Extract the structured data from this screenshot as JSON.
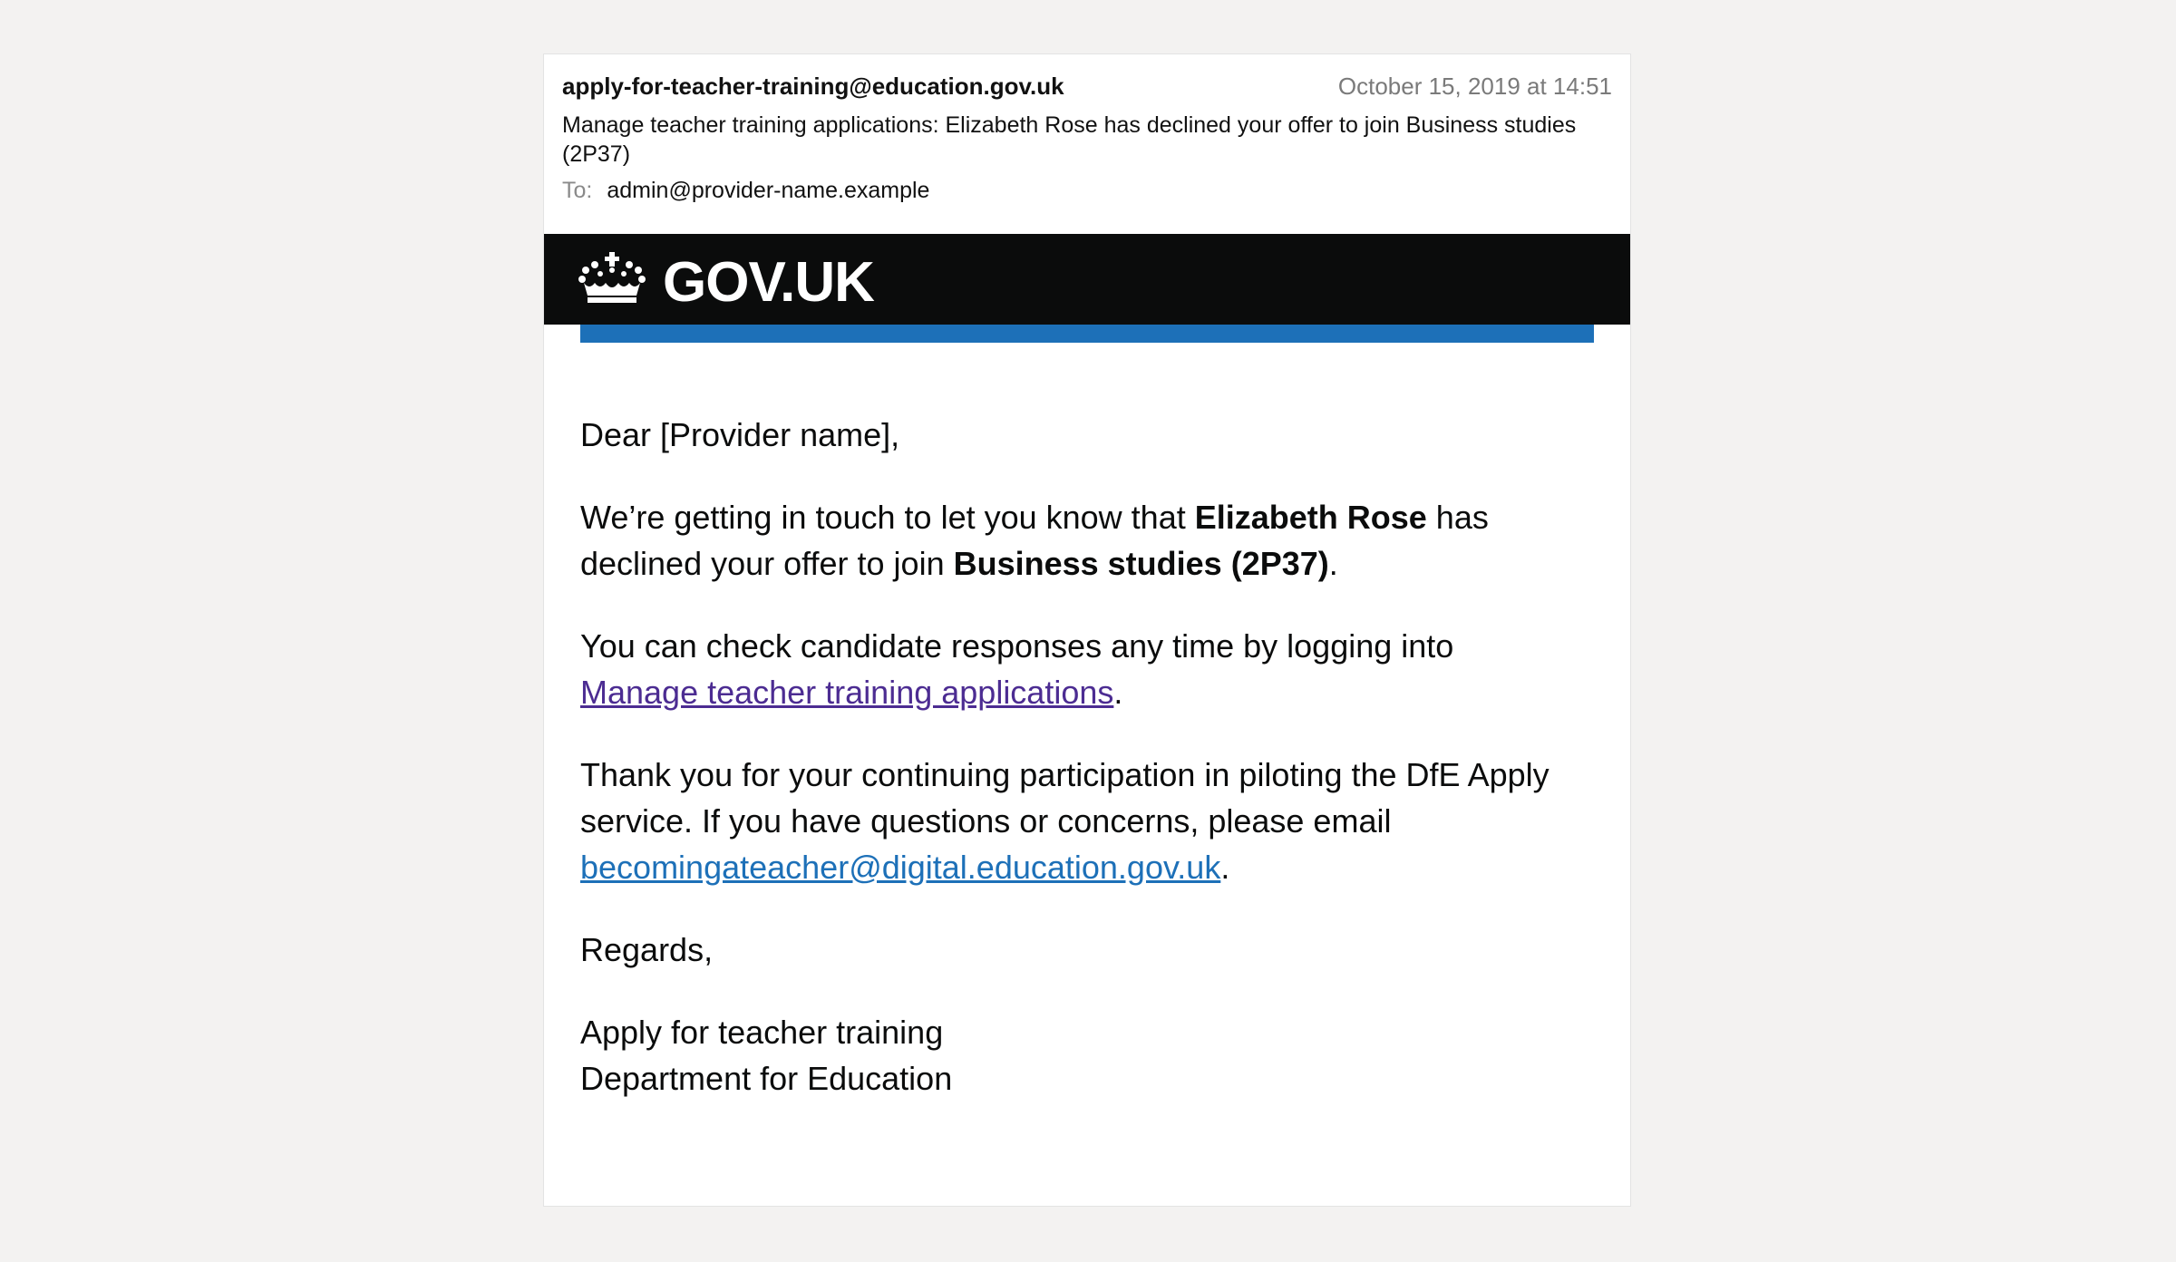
{
  "email": {
    "from": "apply-for-teacher-training@education.gov.uk",
    "date": "October 15, 2019 at 14:51",
    "subject": "Manage teacher training applications: Elizabeth Rose has declined your offer to join Business studies (2P37)",
    "to_label": "To:",
    "to": "admin@provider-name.example"
  },
  "banner": {
    "logo_text": "GOV.UK",
    "logo_icon": "crown-icon",
    "stripe_color": "#1d70b8"
  },
  "body": {
    "greeting": "Dear [Provider name],",
    "p1_a": "We’re getting in touch to let you know that ",
    "p1_name": "Elizabeth Rose",
    "p1_b": " has declined your offer to join ",
    "p1_course": "Business studies (2P37)",
    "p1_end": ".",
    "p2_a": "You can check candidate responses any time by logging into ",
    "p2_link": "Manage teacher training applications",
    "p2_end": ".",
    "p3_a": "Thank you for your continuing participation in piloting the DfE Apply service. If you have questions or concerns, please email ",
    "p3_link": "becomingateacher@digital.education.gov.uk",
    "p3_end": ".",
    "regards": "Regards,",
    "sign1": "Apply for teacher training",
    "sign2": "Department for Education"
  }
}
